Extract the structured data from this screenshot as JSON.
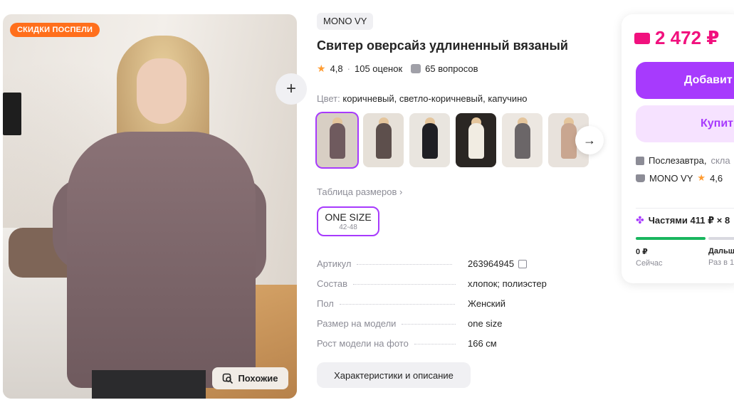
{
  "gallery": {
    "sale_badge": "СКИДКИ ПОСПЕЛИ",
    "similar_label": "Похожие"
  },
  "product": {
    "brand": "MONO VY",
    "title": "Свитер оверсайз удлиненный вязаный",
    "rating": "4,8",
    "reviews": "105 оценок",
    "questions": "65 вопросов",
    "color_label": "Цвет:",
    "color_value": "коричневый, светло-коричневый, капучино",
    "thumbnails": [
      {
        "name": "коричневый",
        "bg": "#d8cfc4",
        "fig": "#6f5a5e"
      },
      {
        "name": "коричневый-2",
        "bg": "#e6e0d8",
        "fig": "#5d4f4c"
      },
      {
        "name": "черный",
        "bg": "#e9e5df",
        "fig": "#1f1f24"
      },
      {
        "name": "белый",
        "bg": "#2a2623",
        "fig": "#f1ece2"
      },
      {
        "name": "капучино",
        "bg": "#ece7e1",
        "fig": "#6b6668"
      },
      {
        "name": "светло-коричневый",
        "bg": "#e8e2dc",
        "fig": "#c9a690"
      }
    ],
    "size_table": "Таблица размеров ›",
    "size_main": "ONE SIZE",
    "size_sub": "42-48",
    "specs": [
      {
        "k": "Артикул",
        "v": "263964945"
      },
      {
        "k": "Состав",
        "v": "хлопок; полиэстер"
      },
      {
        "k": "Пол",
        "v": "Женский"
      },
      {
        "k": "Размер на модели",
        "v": "one size"
      },
      {
        "k": "Рост модели на фото",
        "v": "166 см"
      }
    ],
    "description_button": "Характеристики и описание"
  },
  "buy_panel": {
    "price": "2 472 ₽",
    "add_label": "Добавит",
    "buy_label": "Купит",
    "delivery": "Послезавтра,",
    "delivery_muted": "скла",
    "seller": "MONO VY",
    "seller_rating": "4,6",
    "installments": "Частями 411 ₽ × 8",
    "now_amount": "0 ₽",
    "now_label": "Сейчас",
    "later_amount": "Дальш",
    "later_label": "Раз в 1"
  },
  "colors": {
    "accent": "#a73afd",
    "price": "#f1117e",
    "sale_badge": "#ff6f1c",
    "progress": "#19b65e"
  }
}
